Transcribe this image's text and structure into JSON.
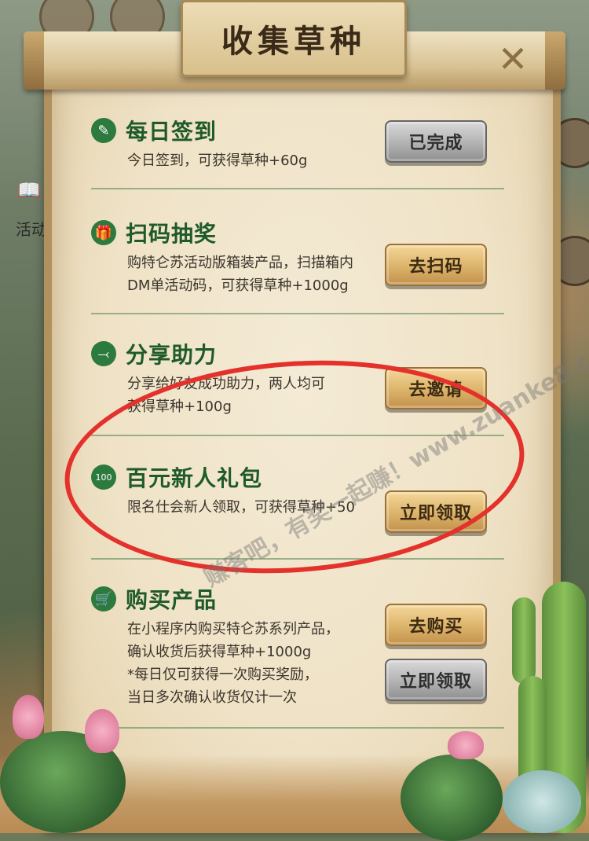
{
  "title": "收集草种",
  "close_icon": "close-icon",
  "left_side": {
    "icon": "book-icon",
    "label": "活动"
  },
  "tasks": [
    {
      "icon": "edit-icon",
      "title": "每日签到",
      "desc": [
        "今日签到，可获得草种+60g"
      ],
      "button": "已完成",
      "button_style": "gray"
    },
    {
      "icon": "gift-icon",
      "title": "扫码抽奖",
      "desc": [
        "购特仑苏活动版箱装产品，扫描箱内",
        "DM单活动码，可获得草种+1000g"
      ],
      "button": "去扫码",
      "button_style": "gold"
    },
    {
      "icon": "share-icon",
      "title": "分享助力",
      "desc": [
        "分享给好友成功助力，两人均可",
        "获得草种+100g"
      ],
      "button": "去邀请",
      "button_style": "gold"
    },
    {
      "icon": "coin-100-icon",
      "title": "百元新人礼包",
      "desc": [
        "限名仕会新人领取，可获得草种+50"
      ],
      "button": "立即领取",
      "button_style": "gold"
    },
    {
      "icon": "cart-icon",
      "title": "购买产品",
      "desc": [
        "在小程序内购买特仑苏系列产品，",
        "确认收货后获得草种+1000g",
        "*每日仅可获得一次购买奖励，",
        "当日多次确认收货仅计一次"
      ],
      "button": "去购买",
      "button_style": "gold",
      "button2": "立即领取",
      "button2_style": "gray"
    }
  ],
  "watermark": "赚客吧，有奖一起赚！www.zuanke8.com",
  "colors": {
    "title_green": "#1f5a2a",
    "icon_green": "#2c7a3d",
    "annotation_red": "#e4312b",
    "btn_gold": "#dcb36a",
    "btn_gray": "#b2b2b2"
  }
}
